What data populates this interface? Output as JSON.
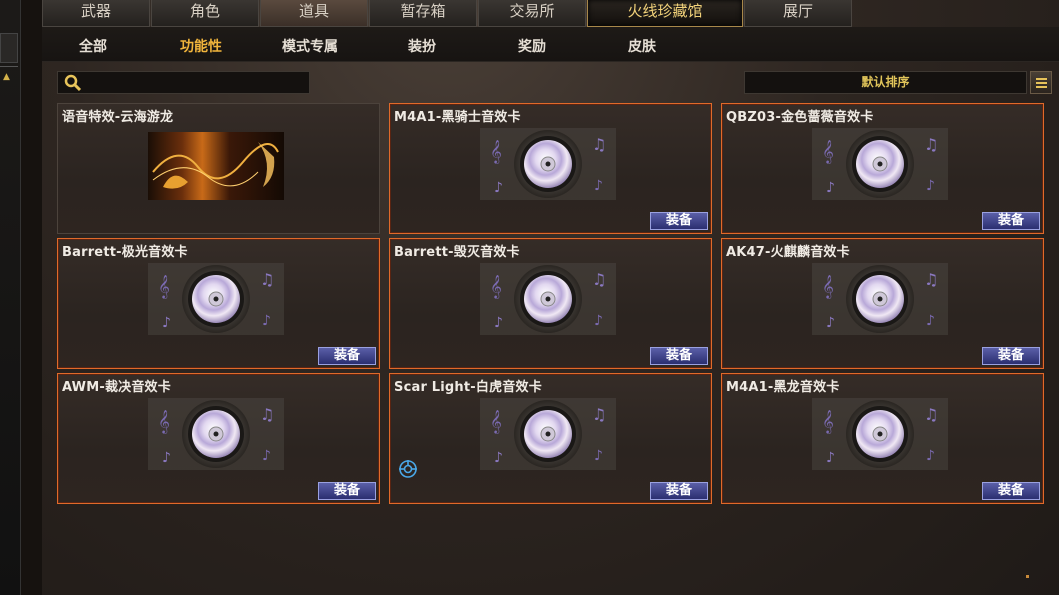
{
  "top_tabs": [
    {
      "label": "武器"
    },
    {
      "label": "角色"
    },
    {
      "label": "道具"
    },
    {
      "label": "暂存箱"
    },
    {
      "label": "交易所"
    },
    {
      "label": "火线珍藏馆"
    },
    {
      "label": "展厅"
    }
  ],
  "sub_tabs": [
    {
      "label": "全部"
    },
    {
      "label": "功能性"
    },
    {
      "label": "模式专属"
    },
    {
      "label": "装扮"
    },
    {
      "label": "奖励"
    },
    {
      "label": "皮肤"
    }
  ],
  "search": {
    "icon": "search-icon",
    "value": ""
  },
  "sort": {
    "label": "默认排序",
    "icon": "list-icon"
  },
  "items": [
    {
      "title": "语音特效-云海游龙",
      "thumb": "dragon"
    },
    {
      "title": "M4A1-黑骑士音效卡",
      "equip": "装备"
    },
    {
      "title": "QBZ03-金色蔷薇音效卡",
      "equip": "装备"
    },
    {
      "title": "Barrett-极光音效卡",
      "equip": "装备"
    },
    {
      "title": "Barrett-毁灭音效卡",
      "equip": "装备"
    },
    {
      "title": "AK47-火麒麟音效卡",
      "equip": "装备"
    },
    {
      "title": "AWM-裁决音效卡",
      "equip": "装备"
    },
    {
      "title": "Scar Light-白虎音效卡",
      "equip": "装备"
    },
    {
      "title": "M4A1-黑龙音效卡",
      "equip": "装备"
    }
  ],
  "colors": {
    "active_tab": "#f2d27a",
    "active_subtab": "#f0b43c",
    "card_border": "#e06a2a",
    "equip_button": "#3a3f8a"
  }
}
